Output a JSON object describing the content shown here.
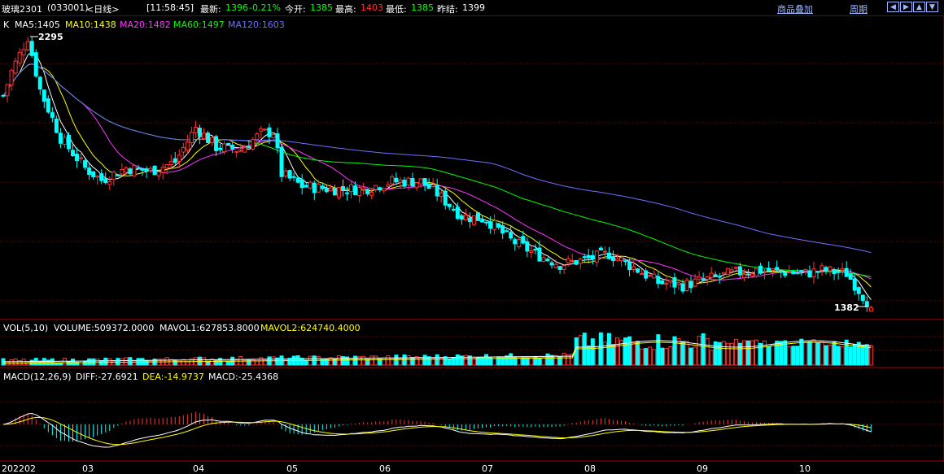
{
  "header": {
    "symbol": "玻璃2301",
    "code": "(033001)",
    "period": "<日线>",
    "time": "[11:58:45]",
    "last_label": "最新:",
    "last_value": "1396",
    "change": "-0.21%",
    "open_label": "今开:",
    "open_value": "1385",
    "high_label": "最高:",
    "high_value": "1403",
    "low_label": "最低:",
    "low_value": "1385",
    "prev_close_label": "昨结:",
    "prev_close_value": "1399",
    "overlay_link": "商品叠加",
    "cycle_link": "周期",
    "nav_icons": [
      "arrow-left-icon",
      "arrow-right-icon",
      "arrow-up-icon",
      "arrow-down-icon"
    ]
  },
  "panels": {
    "price": {
      "prefix": "K",
      "ma5": "MA5:1405",
      "ma10": "MA10:1438",
      "ma20": "MA20:1482",
      "ma60": "MA60:1497",
      "ma120": "MA120:1603",
      "high_marker": "2295",
      "low_marker": "1382"
    },
    "volume": {
      "name": "VOL(5,10)",
      "volume": "VOLUME:509372.0000",
      "mavol1": "MAVOL1:627853.8000",
      "mavol2": "MAVOL2:624740.4000"
    },
    "macd": {
      "name": "MACD(12,26,9)",
      "diff": "DIFF:-27.6921",
      "dea": "DEA:-14.9737",
      "macd": "MACD:-25.4368"
    }
  },
  "xaxis": {
    "labels": [
      "202202",
      "03",
      "04",
      "05",
      "06",
      "07",
      "08",
      "09",
      "10"
    ]
  },
  "colors": {
    "up": "#ff3232",
    "down": "#00ffff",
    "ma5": "#ffffff",
    "ma10": "#ffff00",
    "ma20": "#ff33ff",
    "ma60": "#00ff00",
    "ma120": "#6f6fff",
    "grid": "#8b0000"
  },
  "chart_data": {
    "type": "candlestick",
    "price_range_approx": [
      1380,
      2300
    ],
    "anchors": {
      "period_high": 2295,
      "period_low": 1382,
      "last": 1396,
      "open": 1385,
      "high": 1403,
      "low": 1385,
      "prev_settle": 1399
    },
    "moving_averages": {
      "MA5": 1405,
      "MA10": 1438,
      "MA20": 1482,
      "MA60": 1497,
      "MA120": 1603
    },
    "volume": {
      "VOLUME": 509372.0,
      "MAVOL1": 627853.8,
      "MAVOL2": 624740.4
    },
    "macd": {
      "DIFF": -27.6921,
      "DEA": -14.9737,
      "MACD": -25.4368
    },
    "close_path_approx": [
      {
        "month": "02",
        "close": 2150
      },
      {
        "month": "03",
        "close": 1860
      },
      {
        "month": "04",
        "close": 1900
      },
      {
        "month": "05",
        "close": 1760
      },
      {
        "month": "06",
        "close": 1790
      },
      {
        "month": "07",
        "close": 1580
      },
      {
        "month": "08",
        "close": 1560
      },
      {
        "month": "09",
        "close": 1440
      },
      {
        "month": "10",
        "close": 1420
      }
    ]
  }
}
